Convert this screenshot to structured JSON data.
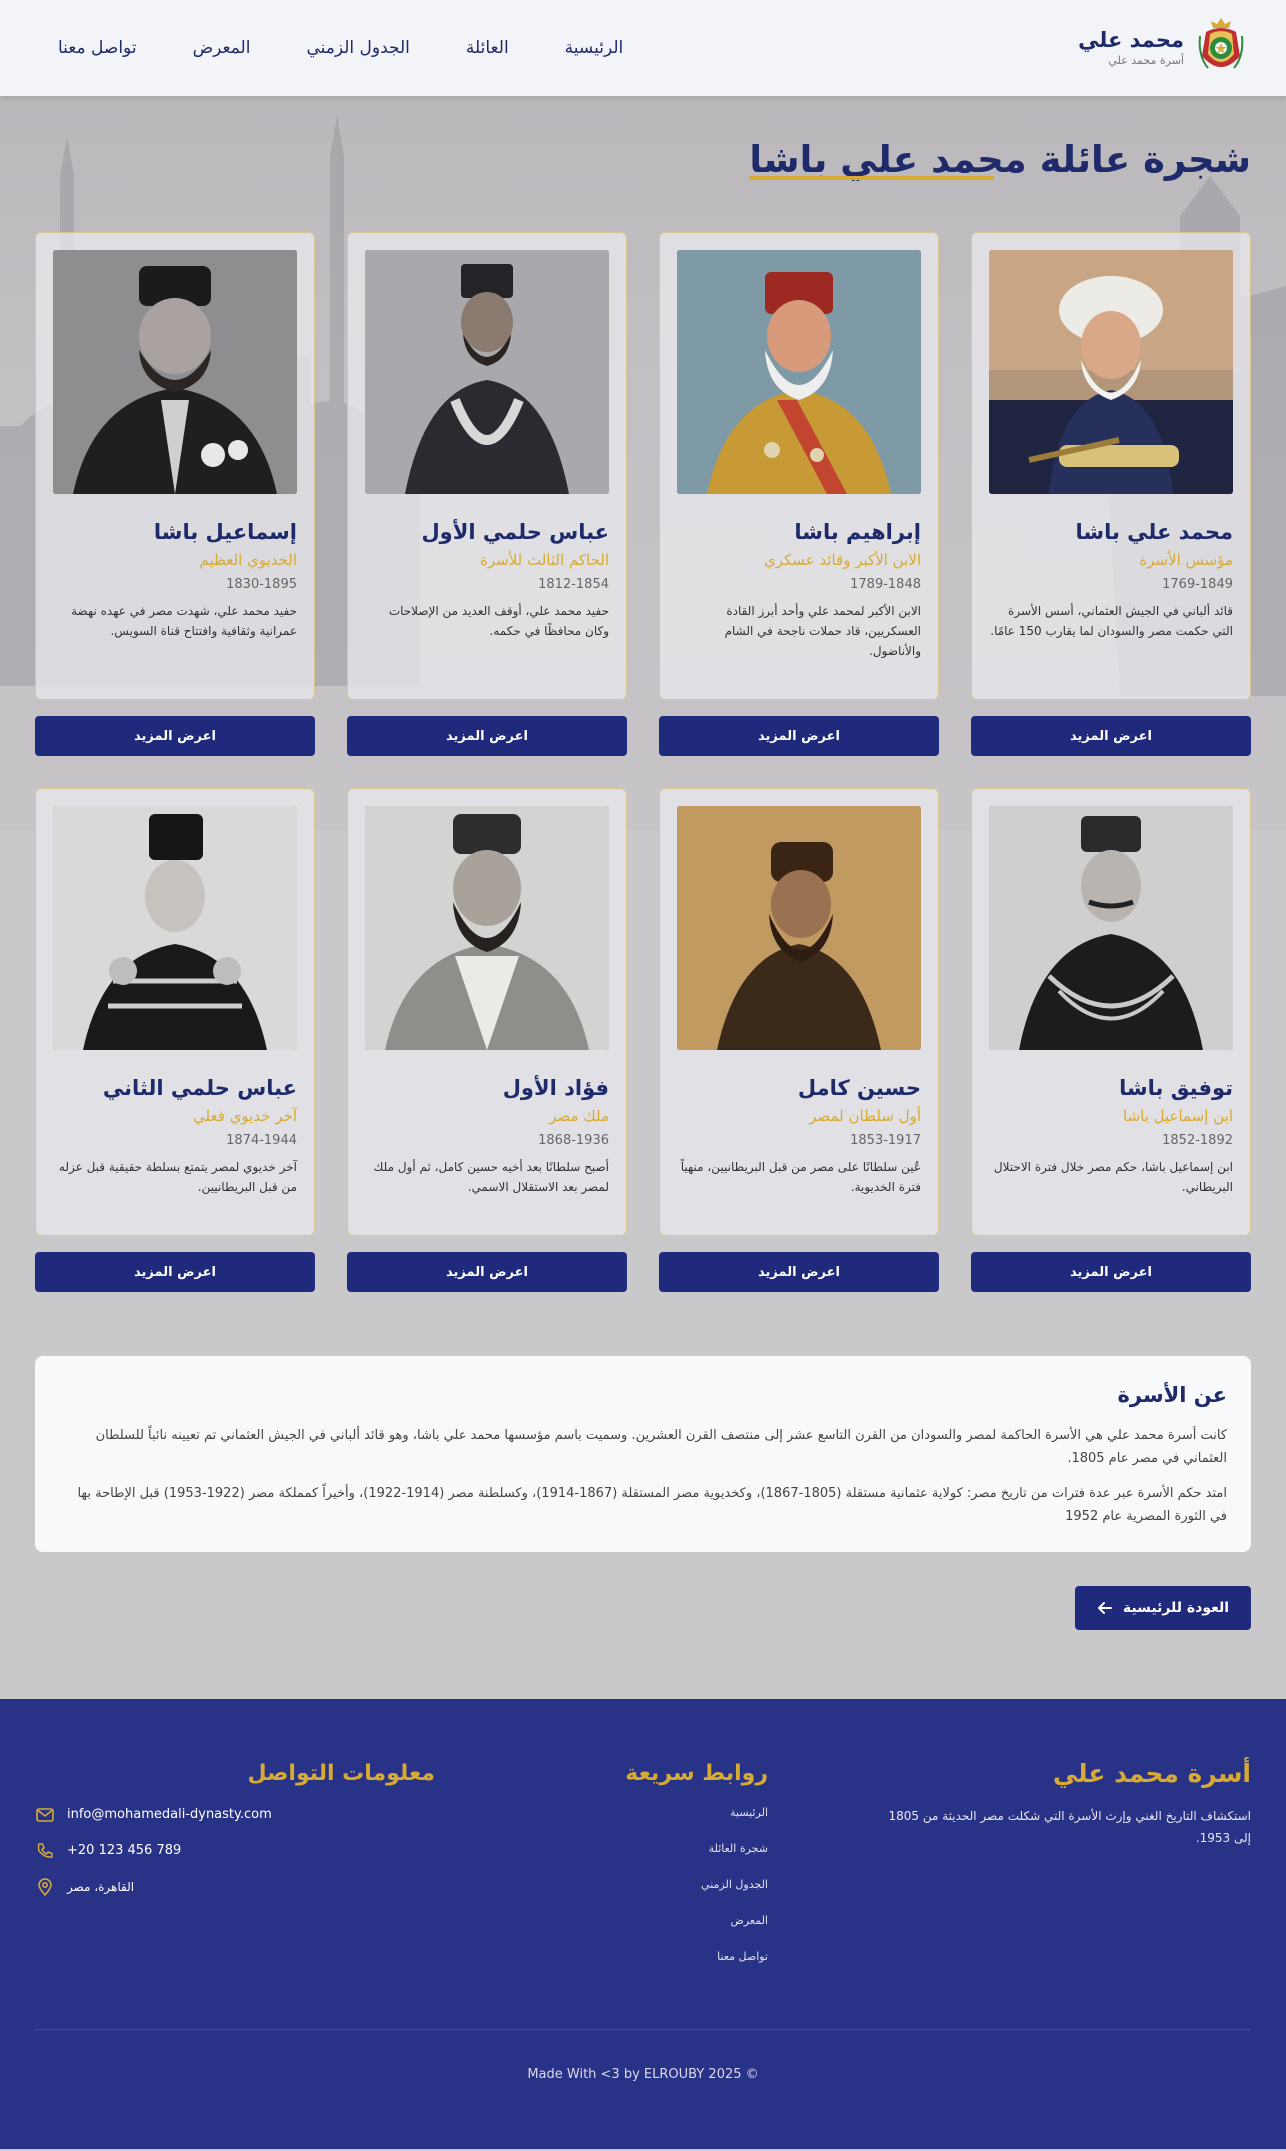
{
  "header": {
    "brand_name": "محمد علي",
    "brand_sub": "أسرة محمد علي",
    "nav": [
      "الرئيسية",
      "العائلة",
      "الجدول الزمني",
      "المعرض",
      "تواصل معنا"
    ]
  },
  "page": {
    "title": "شجرة عائلة محمد علي باشا"
  },
  "cards_row1": [
    {
      "name": "محمد علي باشا",
      "title": "مؤسس الأسرة",
      "years": "1769-1849",
      "desc": "قائد ألباني في الجيش العثماني، أسس الأسرة التي حكمت مصر والسودان لما يقارب 150 عامًا.",
      "button": "اعرض المزيد"
    },
    {
      "name": "إبراهيم باشا",
      "title": "الابن الأكبر وقائد عسكري",
      "years": "1789-1848",
      "desc": "الابن الأكبر لمحمد علي وأحد أبرز القادة العسكريين، قاد حملات ناجحة في الشام والأناضول.",
      "button": "اعرض المزيد"
    },
    {
      "name": "عباس حلمي الأول",
      "title": "الحاكم الثالث للأسرة",
      "years": "1812-1854",
      "desc": "حفيد محمد علي، أوقف العديد من الإصلاحات وكان محافظًا في حكمه.",
      "button": "اعرض المزيد"
    },
    {
      "name": "إسماعيل باشا",
      "title": "الخديوي العظيم",
      "years": "1830-1895",
      "desc": "حفيد محمد علي، شهدت مصر في عهده نهضة عمرانية وثقافية وافتتاح قناة السويس.",
      "button": "اعرض المزيد"
    }
  ],
  "cards_row2": [
    {
      "name": "توفيق باشا",
      "title": "ابن إسماعيل باشا",
      "years": "1852-1892",
      "desc": "ابن إسماعيل باشا، حكم مصر خلال فترة الاحتلال البريطاني.",
      "button": "اعرض المزيد"
    },
    {
      "name": "حسين كامل",
      "title": "أول سلطان لمصر",
      "years": "1853-1917",
      "desc": "عُين سلطانًا على مصر من قبل البريطانيين، منهياً فترة الخديوية.",
      "button": "اعرض المزيد"
    },
    {
      "name": "فؤاد الأول",
      "title": "ملك مصر",
      "years": "1868-1936",
      "desc": "أصبح سلطانًا بعد أخيه حسين كامل، ثم أول ملك لمصر بعد الاستقلال الاسمي.",
      "button": "اعرض المزيد"
    },
    {
      "name": "عباس حلمي الثاني",
      "title": "آخر خديوي فعلي",
      "years": "1874-1944",
      "desc": "آخر خديوي لمصر يتمتع بسلطة حقيقية قبل عزله من قبل البريطانيين.",
      "button": "اعرض المزيد"
    }
  ],
  "about": {
    "heading": "عن الأسرة",
    "p1": "كانت أسرة محمد علي هي الأسرة الحاكمة لمصر والسودان من القرن التاسع عشر إلى منتصف القرن العشرين. وسميت باسم مؤسسها محمد علي باشا، وهو قائد ألباني في الجيش العثماني تم تعيينه نائباً للسلطان العثماني في مصر عام 1805.",
    "p2": "امتد حكم الأسرة عبر عدة فترات من تاريخ مصر: كولاية عثمانية مستقلة (1805-1867)، وكخديوية مصر المستقلة (1867-1914)، وكسلطنة مصر (1914-1922)، وأخيراً كمملكة مصر (1922-1953) قبل الإطاحة بها في الثورة المصرية عام 1952"
  },
  "back_button": "العودة للرئيسية",
  "footer": {
    "about_heading": "أسرة محمد علي",
    "about_text": "استكشاف التاريخ الغني وإرث الأسرة التي شكلت مصر الحديثة من 1805 إلى 1953.",
    "links_heading": "روابط سريعة",
    "links": [
      "الرئيسية",
      "شجرة العائلة",
      "الجدول الزمني",
      "المعرض",
      "تواصل معنا"
    ],
    "contact_heading": "معلومات التواصل",
    "email": "info@mohamedali-dynasty.com",
    "phone": "+20 123 456 789",
    "address": "القاهرة، مصر",
    "copyright": "Made With <3 by ELROUBY 2025 ©"
  },
  "colors": {
    "primary": "#1f2a7c",
    "accent_gold": "#d6aa33",
    "footer_bg": "#283286"
  }
}
